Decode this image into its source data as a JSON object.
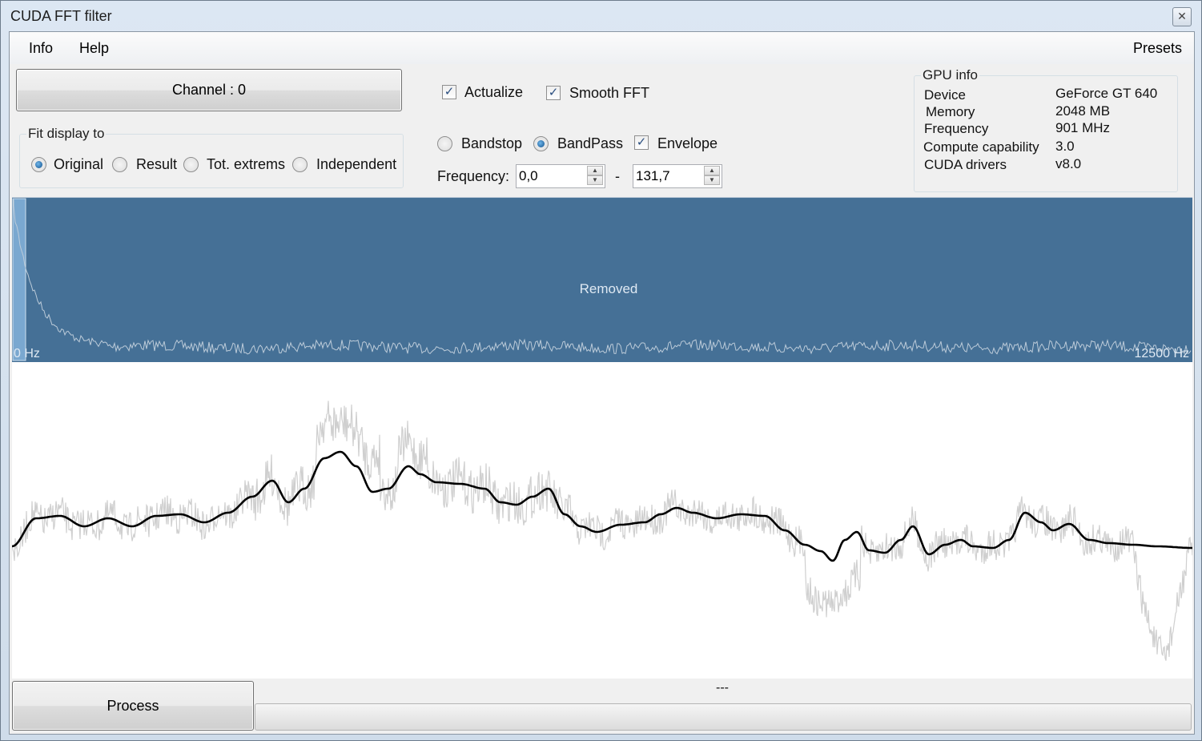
{
  "window": {
    "title": "CUDA FFT filter"
  },
  "menu": {
    "info": "Info",
    "help": "Help",
    "presets": "Presets"
  },
  "channel_button": "Channel : 0",
  "fit_display": {
    "legend": "Fit display to",
    "options": [
      "Original",
      "Result",
      "Tot. extrems",
      "Independent"
    ],
    "selected": "Original"
  },
  "options": {
    "actualize": {
      "label": "Actualize",
      "checked": true
    },
    "smooth_fft": {
      "label": "Smooth FFT",
      "checked": true
    },
    "bandstop": {
      "label": "Bandstop",
      "selected": false
    },
    "bandpass": {
      "label": "BandPass",
      "selected": true
    },
    "envelope": {
      "label": "Envelope",
      "checked": true
    }
  },
  "frequency": {
    "label": "Frequency:",
    "from": "0,0",
    "separator": "-",
    "to": "131,7"
  },
  "gpu_info": {
    "legend": "GPU info",
    "rows": [
      {
        "key": "Device",
        "value": "GeForce GT 640"
      },
      {
        "key": "Memory",
        "value": "2048 MB"
      },
      {
        "key": "Frequency",
        "value": "901 MHz"
      },
      {
        "key": "Compute capability",
        "value": "3.0"
      },
      {
        "key": "CUDA drivers",
        "value": "v8.0"
      }
    ]
  },
  "spectrum": {
    "overlay_label": "Removed",
    "min_label": "0 Hz",
    "max_label": "12500 Hz",
    "background_color": "#457096"
  },
  "process_button": "Process",
  "status_text": "---",
  "colors": {
    "raw_signal": "#cfcfcf",
    "filtered_signal": "#000000"
  }
}
